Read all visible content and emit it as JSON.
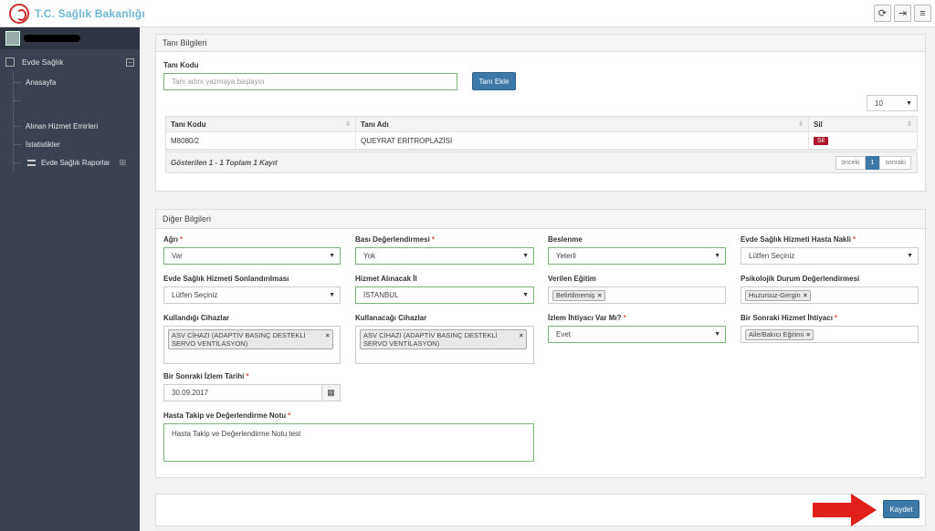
{
  "header": {
    "logo_text": "T.C. Sağlık Bakanlığı",
    "icons": [
      "refresh-icon",
      "logout-icon",
      "menu-icon"
    ]
  },
  "sidebar": {
    "menu_title": "Evde Sağlık",
    "items": [
      {
        "label": "Anasayfa"
      },
      {
        "label": ""
      },
      {
        "label": "Alınan Hizmet Emirleri"
      },
      {
        "label": "İstatistikler"
      },
      {
        "label": "Evde Sağlık Raporlar"
      }
    ]
  },
  "diagnosis": {
    "title": "Tanı Bilgileri",
    "code_label": "Tanı Kodu",
    "search_placeholder": "Tanı adını yazmaya başlayın",
    "add_button": "Tanı Ekle",
    "page_size": "10",
    "columns": [
      "Tanı Kodu",
      "Tanı Adı",
      "Sil"
    ],
    "rows": [
      {
        "code": "M8080/2",
        "name": "QUEYRAT ERİTROPLAZİSİ",
        "action": "Sil"
      }
    ],
    "footer": "Gösterilen 1 - 1 Toplam 1 Kayıt",
    "pager": {
      "prev": "önceki",
      "current": "1",
      "next": "sonraki"
    }
  },
  "other": {
    "title": "Diğer Bilgileri",
    "agri": {
      "label": "Ağrı",
      "value": "Var"
    },
    "basi": {
      "label": "Bası Değerlendirmesi",
      "value": "Yok"
    },
    "beslenme": {
      "label": "Beslenme",
      "value": "Yeterli"
    },
    "nakil": {
      "label": "Evde Sağlık Hizmeti Hasta Nakli",
      "value": "Lütfen Seçiniz"
    },
    "sonlandirma": {
      "label": "Evde Sağlık Hizmeti Sonlandırılması",
      "value": "Lütfen Seçiniz"
    },
    "il": {
      "label": "Hizmet Alınacak İl",
      "value": "İSTANBUL"
    },
    "egitim": {
      "label": "Verilen Eğitim",
      "tag": "Belirtilmemiş"
    },
    "psikolojik": {
      "label": "Psikolojik Durum Değerlendirmesi",
      "tag": "Huzursuz-Gergin"
    },
    "kullandigi": {
      "label": "Kullandığı Cihazlar",
      "tag": "ASV CİHAZI (ADAPTİV BASINÇ DESTEKLİ SERVO VENTİLASYON)"
    },
    "kullanacagi": {
      "label": "Kullanacağı Cihazlar",
      "tag": "ASV CİHAZI (ADAPTİV BASINÇ DESTEKLİ SERVO VENTİLASYON)"
    },
    "izlem_ihtiyac": {
      "label": "İzlem İhtiyacı Var Mı?",
      "value": "Evet"
    },
    "sonraki_hizmet": {
      "label": "Bir Sonraki Hizmet İhtiyacı",
      "tag": "Aile/Bakıcı Eğitimi"
    },
    "izlem_tarihi": {
      "label": "Bir Sonraki İzlem Tarihi",
      "value": "30.09.2017"
    },
    "not": {
      "label": "Hasta Takip ve Değerlendirme Notu",
      "value": "Hasta Takip ve Değerlendirme Notu test"
    }
  },
  "footer": {
    "save_button": "Kaydet"
  },
  "colors": {
    "primary": "#3c78a8",
    "danger": "#b0152a",
    "sidebar": "#3a4150",
    "arrow": "#e0201a"
  }
}
